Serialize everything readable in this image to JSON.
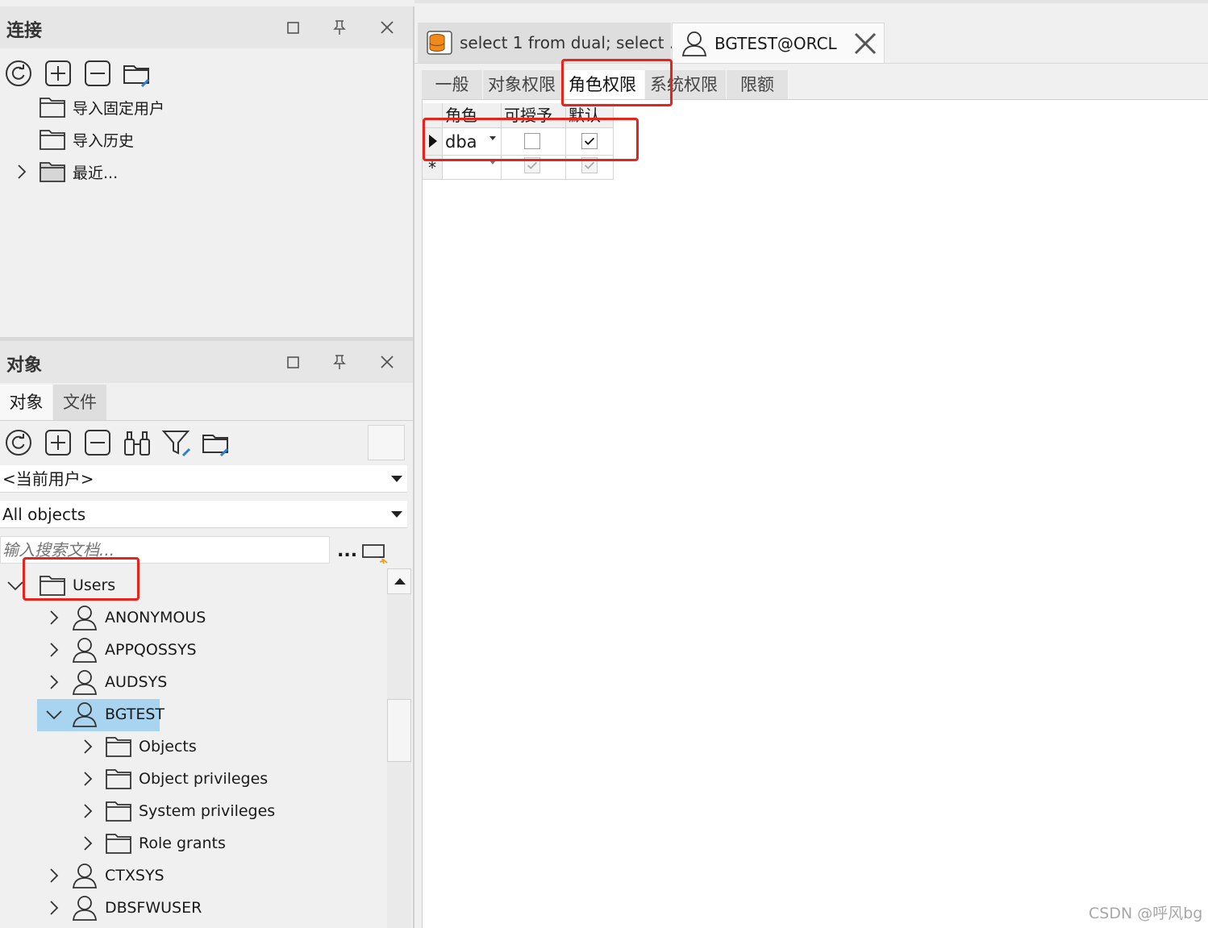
{
  "connection_panel": {
    "title": "连接",
    "tree": [
      {
        "label": "导入固定用户"
      },
      {
        "label": "导入历史"
      },
      {
        "label": "最近..."
      }
    ]
  },
  "objects_panel": {
    "title": "对象",
    "tabs": [
      "对象",
      "文件"
    ],
    "user_select": "<当前用户>",
    "type_select": "All objects",
    "search_placeholder": "输入搜索文档...",
    "more_label": "...",
    "tree": {
      "root": "Users",
      "users": [
        "ANONYMOUS",
        "APPQOSSYS",
        "AUDSYS",
        "BGTEST",
        "CTXSYS",
        "DBSFWUSER"
      ],
      "selected_user": "BGTEST",
      "bgtest_children": [
        "Objects",
        "Object privileges",
        "System privileges",
        "Role grants"
      ]
    }
  },
  "editor": {
    "tabs": [
      {
        "label": "select 1 from dual; select ..."
      },
      {
        "label": "BGTEST@ORCL"
      }
    ],
    "subtabs": [
      "一般",
      "对象权限",
      "角色权限",
      "系统权限",
      "限额"
    ],
    "active_subtab": "角色权限",
    "grid": {
      "columns": [
        "角色",
        "可授予",
        "默认"
      ],
      "rows": [
        {
          "role": "dba",
          "grantable": false,
          "default": true
        }
      ],
      "new_row_marker": "*"
    }
  },
  "watermark": "CSDN @呼风bg",
  "colors": {
    "highlight_red": "#e8231b",
    "selection_blue": "#a9d4f0",
    "db_icon_orange": "#f08a1c"
  }
}
